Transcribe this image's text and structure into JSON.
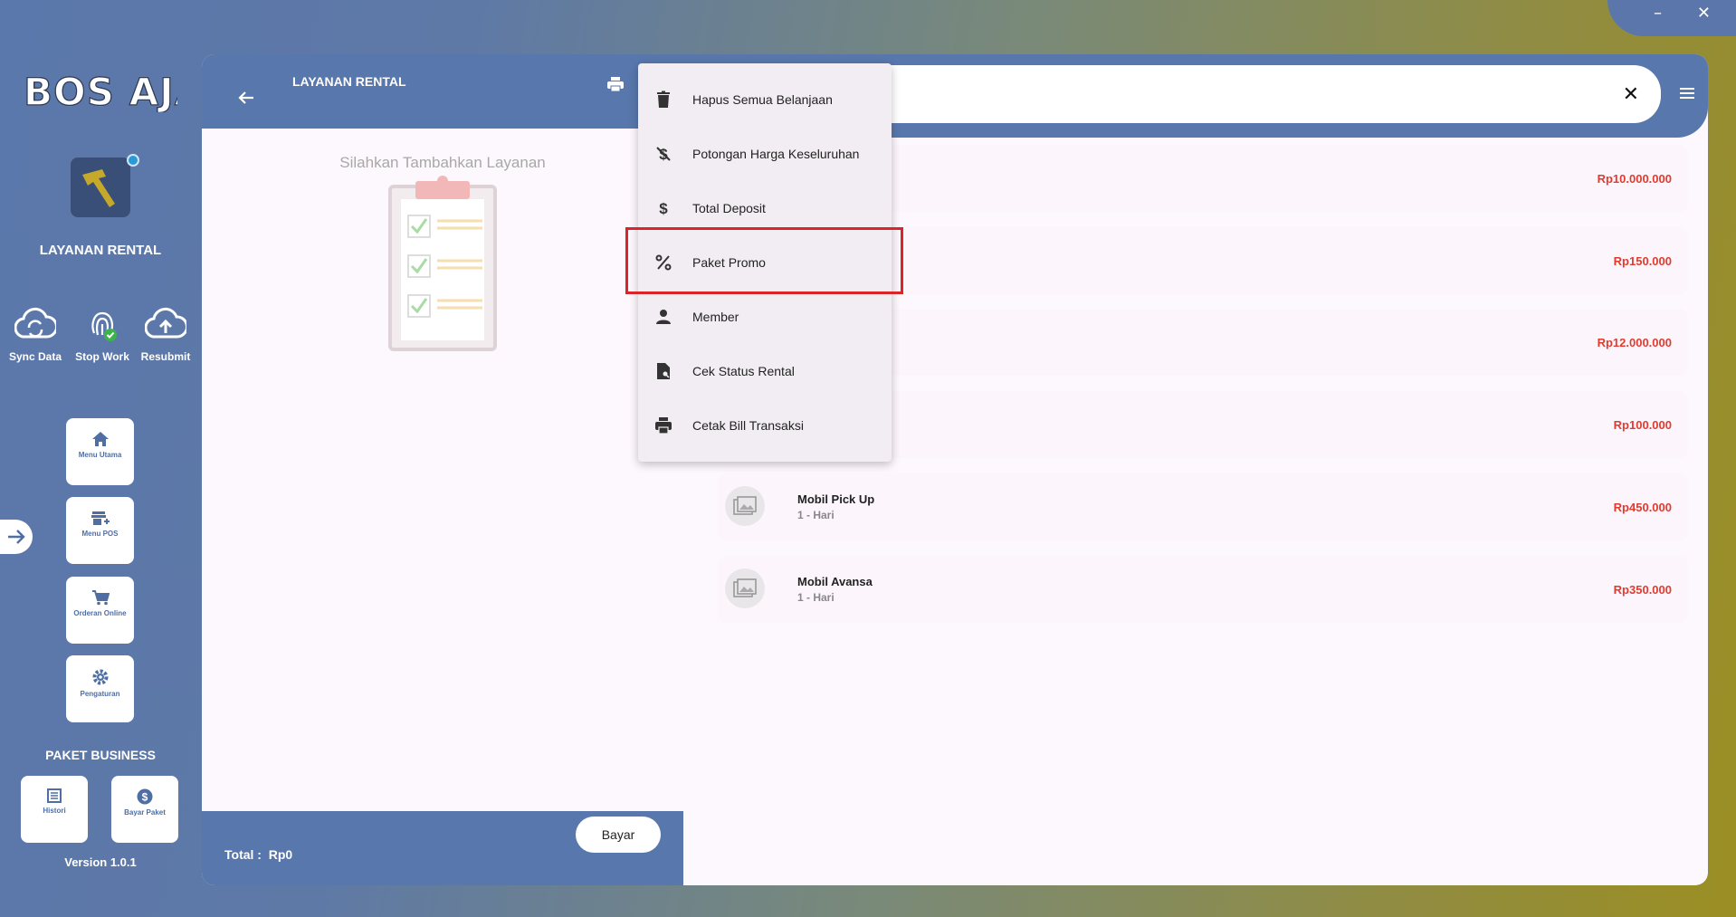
{
  "window": {
    "minimize": "–",
    "close": "✕"
  },
  "sidebar": {
    "logo": "BOS AJA",
    "title": "LAYANAN RENTAL",
    "quick_actions": [
      {
        "label": "Sync Data",
        "icon": "cloud-sync-icon"
      },
      {
        "label": "Stop Work",
        "icon": "fingerprint-icon"
      },
      {
        "label": "Resubmit",
        "icon": "cloud-upload-icon"
      }
    ],
    "nav": [
      {
        "label": "Menu Utama",
        "icon": "home-icon"
      },
      {
        "label": "Menu POS",
        "icon": "store-icon"
      },
      {
        "label": "Orderan Online",
        "icon": "cart-icon"
      },
      {
        "label": "Pengaturan",
        "icon": "gear-icon"
      }
    ],
    "package_title": "PAKET BUSINESS",
    "package_buttons": [
      {
        "label": "Histori",
        "icon": "list-icon"
      },
      {
        "label": "Bayar Paket",
        "icon": "dollar-icon"
      }
    ],
    "version": "Version 1.0.1"
  },
  "cart": {
    "title": "LAYANAN RENTAL",
    "empty_text": "Silahkan Tambahkan Layanan",
    "total_label": "Total :",
    "total_value": "Rp0",
    "pay_label": "Bayar"
  },
  "search": {
    "value": "",
    "clear": "✕"
  },
  "services": [
    {
      "name": "",
      "duration": "",
      "price": "Rp10.000.000"
    },
    {
      "name": "",
      "duration": "",
      "price": "Rp150.000"
    },
    {
      "name": "",
      "duration": "",
      "price": "Rp12.000.000"
    },
    {
      "name": "",
      "duration": "",
      "price": "Rp100.000"
    },
    {
      "name": "Mobil Pick Up",
      "duration": "1 - Hari",
      "price": "Rp450.000"
    },
    {
      "name": "Mobil Avansa",
      "duration": "1 - Hari",
      "price": "Rp350.000"
    }
  ],
  "dropdown": [
    {
      "label": "Hapus Semua Belanjaan",
      "icon": "trash-icon"
    },
    {
      "label": "Potongan Harga Keseluruhan",
      "icon": "money-off-icon"
    },
    {
      "label": "Total Deposit",
      "icon": "dollar-icon"
    },
    {
      "label": "Paket Promo",
      "icon": "percent-icon"
    },
    {
      "label": "Member",
      "icon": "person-icon"
    },
    {
      "label": "Cek Status Rental",
      "icon": "document-search-icon"
    },
    {
      "label": "Cetak Bill Transaksi",
      "icon": "printer-icon"
    }
  ],
  "colors": {
    "primary": "#5877ad",
    "price": "#e03b2e",
    "highlight": "#d9252a"
  }
}
